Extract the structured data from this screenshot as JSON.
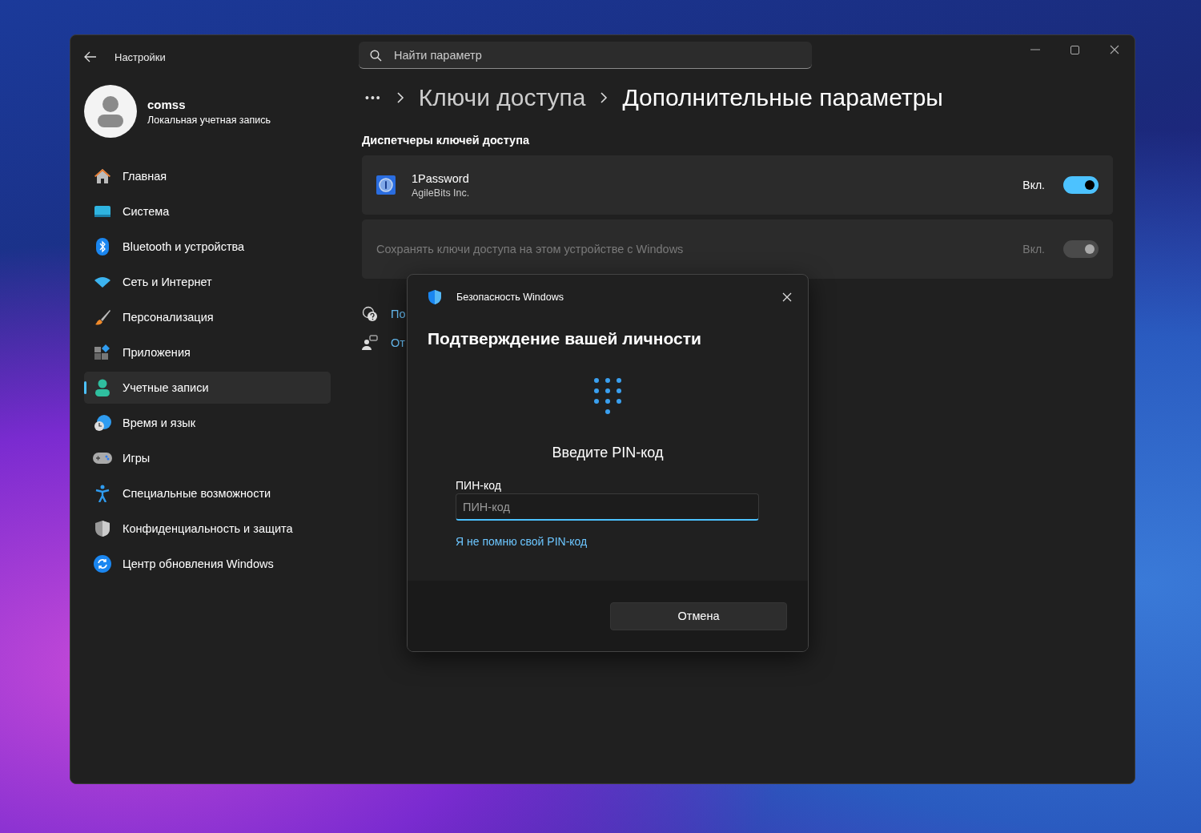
{
  "window": {
    "title": "Настройки",
    "search": {
      "placeholder": "Найти параметр"
    }
  },
  "account": {
    "name": "comss",
    "type": "Локальная учетная запись"
  },
  "sidebar": {
    "items": [
      {
        "label": "Главная",
        "selected": false
      },
      {
        "label": "Система",
        "selected": false
      },
      {
        "label": "Bluetooth и устройства",
        "selected": false
      },
      {
        "label": "Сеть и Интернет",
        "selected": false
      },
      {
        "label": "Персонализация",
        "selected": false
      },
      {
        "label": "Приложения",
        "selected": false
      },
      {
        "label": "Учетные записи",
        "selected": true
      },
      {
        "label": "Время и язык",
        "selected": false
      },
      {
        "label": "Игры",
        "selected": false
      },
      {
        "label": "Специальные возможности",
        "selected": false
      },
      {
        "label": "Конфиденциальность и защита",
        "selected": false
      },
      {
        "label": "Центр обновления Windows",
        "selected": false
      }
    ]
  },
  "breadcrumb": {
    "overflow": "•••",
    "items": [
      "Ключи доступа",
      "Дополнительные параметры"
    ]
  },
  "section_title": "Диспетчеры ключей доступа",
  "providers": [
    {
      "kind": "app",
      "name": "1Password",
      "publisher": "AgileBits Inc.",
      "state_label": "Вкл.",
      "on": true,
      "disabled": false
    },
    {
      "kind": "plain",
      "name": "Сохранять ключи доступа на этом устройстве с Windows",
      "state_label": "Вкл.",
      "on": true,
      "disabled": true
    }
  ],
  "links": [
    "По",
    "От"
  ],
  "dialog": {
    "app": "Безопасность Windows",
    "title": "Подтверждение вашей личности",
    "prompt": "Введите PIN-код",
    "field_label": "ПИН-код",
    "placeholder": "ПИН-код",
    "forgot_link": "Я не помню свой PIN-код",
    "cancel": "Отмена"
  }
}
